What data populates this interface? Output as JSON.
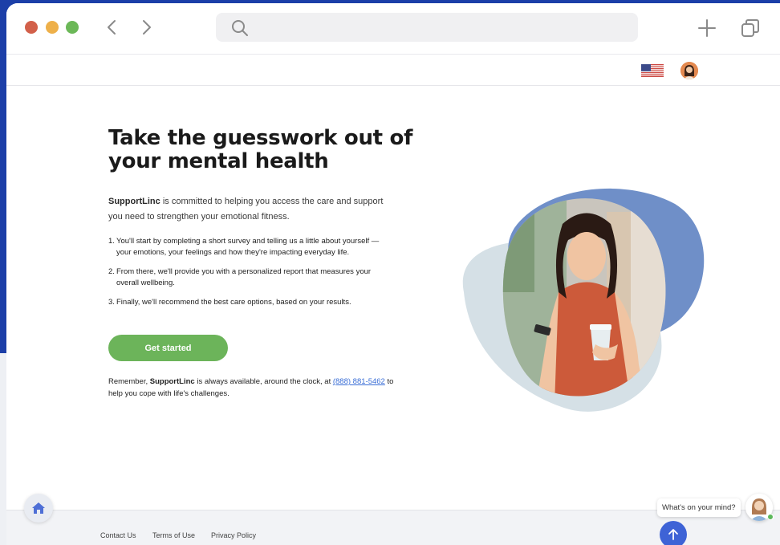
{
  "chrome": {
    "url_value": "",
    "colors": {
      "close": "#d2604a",
      "minimize": "#eeb04a",
      "maximize": "#6cb858"
    },
    "icons": [
      "back-arrow-icon",
      "forward-arrow-icon",
      "search-icon",
      "plus-icon",
      "tabs-icon"
    ]
  },
  "header": {
    "icons": [
      "us-flag-icon",
      "user-avatar"
    ]
  },
  "main": {
    "headline": "Take the guesswork out of your mental health",
    "intro_brand": "SupportLinc",
    "intro_text": " is committed to helping you access the care and support you need to strengthen your emotional fitness.",
    "steps": [
      {
        "num": "1.",
        "text": "You'll start by completing a short survey and telling us a little about yourself — your emotions, your feelings and how they're impacting everyday life."
      },
      {
        "num": "2.",
        "text": "From there, we'll provide you with a personalized report that measures your overall wellbeing."
      },
      {
        "num": "3.",
        "text": "Finally, we'll recommend the best care options, based on your results."
      }
    ],
    "cta_label": "Get started",
    "reminder_prefix": "Remember, ",
    "reminder_brand": "SupportLinc",
    "reminder_middle": " is always available, around the clock, at ",
    "reminder_phone": "(888) 881-5462",
    "reminder_suffix": " to help you cope with life's challenges.",
    "colors": {
      "cta": "#6cb45a",
      "link": "#3a6ed6",
      "blob_blue": "#6f8fc8",
      "blob_pale": "#d5e0e6"
    }
  },
  "footer": {
    "links": [
      "Contact Us",
      "Terms of Use",
      "Privacy Policy"
    ]
  },
  "chat": {
    "prompt": "What's on your mind?"
  }
}
